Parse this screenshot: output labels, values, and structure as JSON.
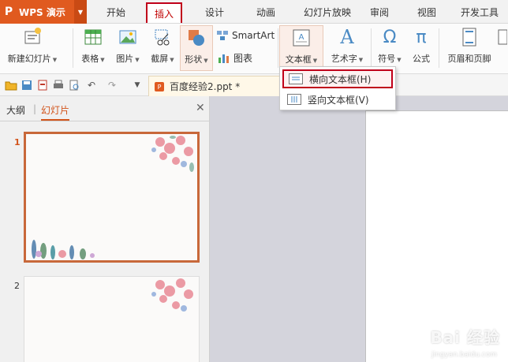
{
  "app": {
    "logo": "P",
    "name": "WPS 演示"
  },
  "menu": {
    "tabs": [
      {
        "label": "开始"
      },
      {
        "label": "插入",
        "active": true
      },
      {
        "label": "设计"
      },
      {
        "label": "动画"
      },
      {
        "label": "幻灯片放映"
      },
      {
        "label": "审阅"
      },
      {
        "label": "视图"
      },
      {
        "label": "开发工具"
      }
    ]
  },
  "ribbon": {
    "new_slide": "新建幻灯片",
    "table": "表格",
    "picture": "图片",
    "screenshot": "截屏",
    "shape": "形状",
    "smartart": "SmartArt",
    "chart": "图表",
    "textbox": "文本框",
    "wordart": "艺术字",
    "symbol": "符号",
    "formula": "公式",
    "header_footer": "页眉和页脚",
    "caret": "▾"
  },
  "document": {
    "tab_label": "百度经验2.ppt *"
  },
  "panel": {
    "tab_outline": "大纲",
    "tab_slides": "幻灯片",
    "slide_numbers": [
      "1",
      "2"
    ]
  },
  "dropdown": {
    "items": [
      {
        "label": "横向文本框(H)",
        "highlighted": true
      },
      {
        "label": "竖向文本框(V)"
      }
    ]
  },
  "watermark": {
    "text": "Bai 经验",
    "sub": "jingyan.baidu.com"
  },
  "colors": {
    "accent": "#e05a1f",
    "highlight": "#c0001a"
  }
}
